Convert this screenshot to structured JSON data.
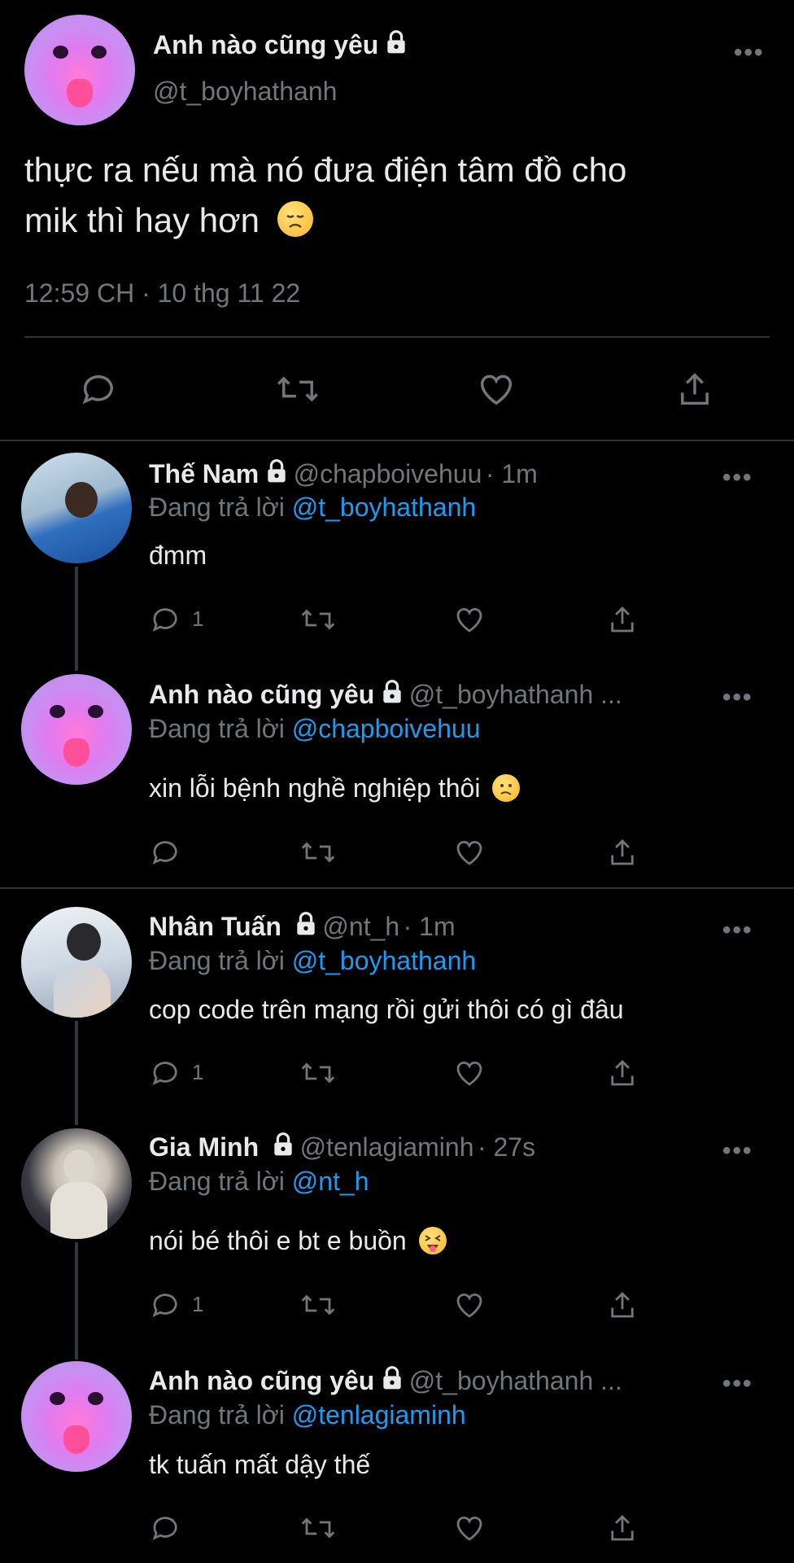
{
  "main_tweet": {
    "author_name": "Anh nào cũng yêu",
    "handle": "@t_boyhathanh",
    "text_line1": "thực ra nếu mà nó đưa điện tâm đồ cho",
    "text_line2": "mik thì hay hơn",
    "timestamp": "12:59 CH · 10 thg 11 22",
    "more_label": "•••"
  },
  "replying_prefix": "Đang trả lời",
  "replies": [
    {
      "author_name": "Thế Nam",
      "handle": "@chapboivehuu",
      "time": "· 1m",
      "replying_to": "@t_boyhathanh",
      "text": "đmm",
      "reply_count": "1"
    },
    {
      "author_name": "Anh nào cũng yêu",
      "handle": "@t_boyhathanh ...",
      "time": "",
      "replying_to": "@chapboivehuu",
      "text": "xin lỗi bệnh nghề nghiệp thôi",
      "reply_count": ""
    },
    {
      "author_name": "Nhân Tuấn",
      "handle": "@nt_h",
      "time": "· 1m",
      "replying_to": "@t_boyhathanh",
      "text": "cop code trên mạng rồi gửi thôi có gì đâu",
      "reply_count": "1"
    },
    {
      "author_name": "Gia Minh",
      "handle": "@tenlagiaminh",
      "time": "· 27s",
      "replying_to": "@nt_h",
      "text": "nói bé thôi e bt e buồn",
      "reply_count": "1"
    },
    {
      "author_name": "Anh nào cũng yêu",
      "handle": "@t_boyhathanh ...",
      "time": "",
      "replying_to": "@tenlagiaminh",
      "text": "tk tuấn mất dậy thế",
      "reply_count": ""
    }
  ],
  "icons": {
    "reply": "reply-icon",
    "retweet": "retweet-icon",
    "like": "heart-icon",
    "share": "share-icon",
    "lock": "lock-icon",
    "more": "more-icon"
  },
  "colors": {
    "background": "#000000",
    "text": "#e7e9ea",
    "secondary": "#71767b",
    "mention": "#1d9bf0",
    "divider": "#2f3336"
  }
}
